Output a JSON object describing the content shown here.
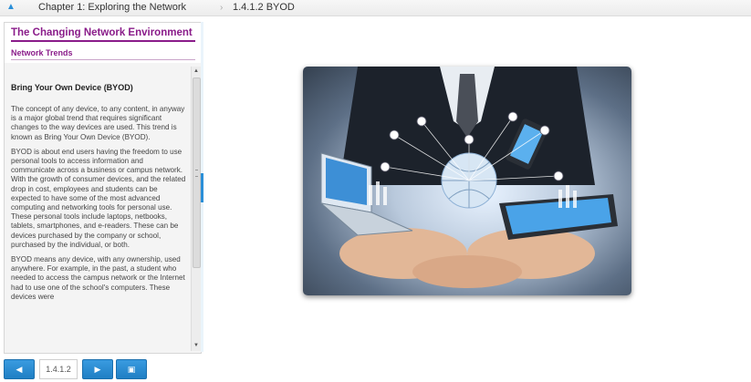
{
  "breadcrumb": {
    "chapter": "Chapter 1: Exploring the Network",
    "section": "1.4.1.2 BYOD"
  },
  "module": {
    "title": "The Changing Network Environment",
    "subtitle": "Network Trends"
  },
  "content": {
    "heading": "Bring Your Own Device (BYOD)",
    "paragraphs": [
      "The concept of any device, to any content, in anyway is a major global trend that requires significant changes to the way devices are used. This trend is known as Bring Your Own Device (BYOD).",
      "BYOD is about end users having the freedom to use personal tools to access information and communicate across a business or campus network. With the growth of consumer devices, and the related drop in cost, employees and students can be expected to have some of the most advanced computing and networking tools for personal use. These personal tools include laptops, netbooks, tablets, smartphones, and e-readers. These can be devices purchased by the company or school, purchased by the individual, or both.",
      "BYOD means any device, with any ownership, used anywhere. For example, in the past, a student who needed to access the campus network or the Internet had to use one of the school's computers. These devices were"
    ]
  },
  "nav": {
    "page": "1.4.1.2",
    "prev_icon": "left-arrow-icon",
    "next_icon": "right-arrow-icon",
    "menu_icon": "menu-icon"
  },
  "colors": {
    "accent": "#2a8fd8",
    "module_title": "#8a1c8a"
  }
}
